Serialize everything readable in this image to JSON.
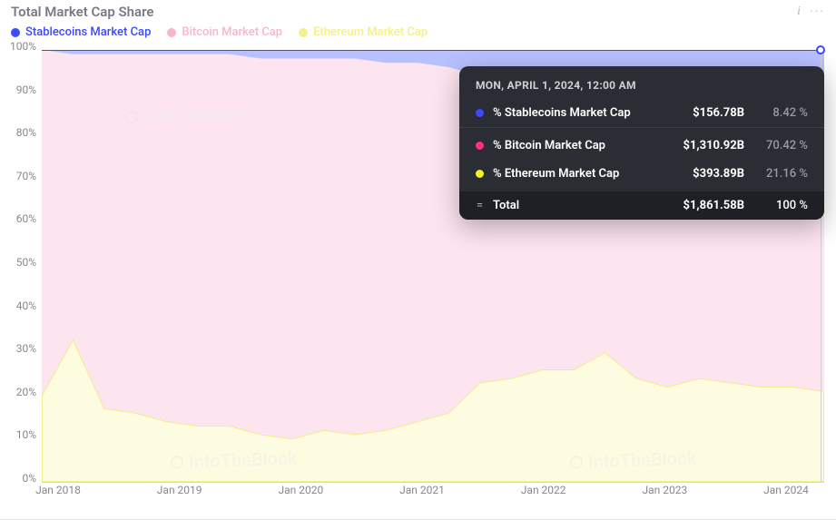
{
  "header": {
    "title": "Total Market Cap Share"
  },
  "legend": {
    "items": [
      {
        "label": "Stablecoins Market Cap",
        "color": "#3b49ff"
      },
      {
        "label": "Bitcoin Market Cap",
        "color": "#f7b6cf"
      },
      {
        "label": "Ethereum Market Cap",
        "color": "#f5f088"
      }
    ]
  },
  "y_axis": {
    "ticks": [
      "100%",
      "90%",
      "80%",
      "70%",
      "60%",
      "50%",
      "40%",
      "30%",
      "20%",
      "10%",
      "0%"
    ]
  },
  "x_axis": {
    "ticks": [
      "Jan 2018",
      "Jan 2019",
      "Jan 2020",
      "Jan 2021",
      "Jan 2022",
      "Jan 2023",
      "Jan 2024"
    ]
  },
  "tooltip": {
    "date": "MON, APRIL 1, 2024, 12:00 AM",
    "rows": [
      {
        "color": "#3b49ff",
        "name": "% Stablecoins Market Cap",
        "value": "$156.78B",
        "pct": "8.42 %"
      },
      {
        "color": "#ff2d87",
        "name": "% Bitcoin Market Cap",
        "value": "$1,310.92B",
        "pct": "70.42 %"
      },
      {
        "color": "#f5f020",
        "name": "% Ethereum Market Cap",
        "value": "$393.89B",
        "pct": "21.16 %"
      }
    ],
    "total": {
      "name": "Total",
      "value": "$1,861.58B",
      "pct": "100 %"
    }
  },
  "watermark": "IntoTheBlock",
  "chart_data": {
    "type": "area",
    "title": "Total Market Cap Share",
    "ylabel": "%",
    "ylim": [
      0,
      100
    ],
    "stacked": true,
    "x": [
      "2018-01",
      "2018-04",
      "2018-07",
      "2018-10",
      "2019-01",
      "2019-04",
      "2019-07",
      "2019-10",
      "2020-01",
      "2020-04",
      "2020-07",
      "2020-10",
      "2021-01",
      "2021-04",
      "2021-07",
      "2021-10",
      "2022-01",
      "2022-04",
      "2022-07",
      "2022-10",
      "2023-01",
      "2023-04",
      "2023-07",
      "2023-10",
      "2024-01",
      "2024-04"
    ],
    "series": [
      {
        "name": "Ethereum Market Cap",
        "color": "#f5f088",
        "values": [
          20,
          33,
          17,
          16,
          14,
          13,
          13,
          11,
          10,
          12,
          11,
          12,
          14,
          16,
          23,
          24,
          26,
          26,
          30,
          24,
          22,
          24,
          23,
          22,
          22,
          21
        ]
      },
      {
        "name": "Bitcoin Market Cap",
        "color": "#f7b6cf",
        "values": [
          80,
          66,
          82,
          83,
          85,
          86,
          86,
          87,
          88,
          86,
          87,
          85,
          83,
          80,
          71,
          70,
          66,
          63,
          56,
          62,
          66,
          65,
          67,
          68,
          70,
          71
        ]
      },
      {
        "name": "Stablecoins Market Cap",
        "color": "#a8b0ff",
        "values": [
          0,
          1,
          1,
          1,
          1,
          1,
          1,
          2,
          2,
          2,
          2,
          3,
          3,
          4,
          6,
          6,
          8,
          11,
          14,
          14,
          12,
          11,
          10,
          10,
          8,
          8
        ]
      }
    ],
    "x_tick_labels": [
      "Jan 2018",
      "Jan 2019",
      "Jan 2020",
      "Jan 2021",
      "Jan 2022",
      "Jan 2023",
      "Jan 2024"
    ]
  }
}
